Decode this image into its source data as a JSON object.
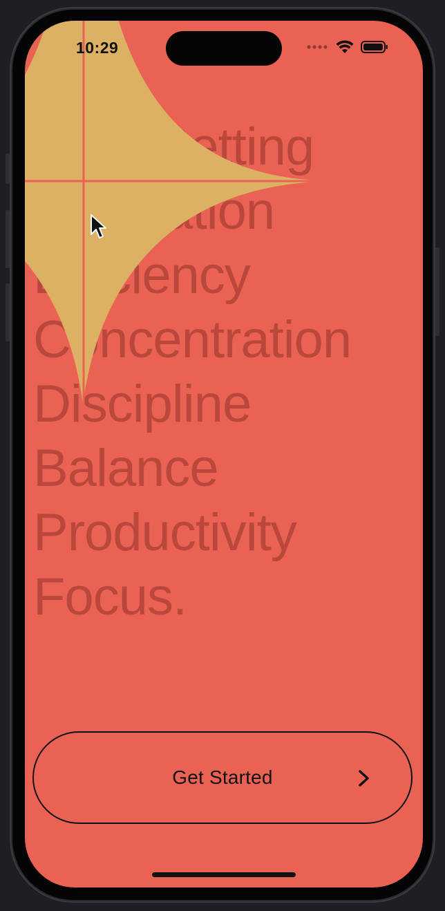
{
  "status_bar": {
    "time": "10:29",
    "icons": [
      "cellular-icon",
      "wifi-icon",
      "battery-icon"
    ]
  },
  "words": [
    "Goal Setting",
    "Dedication",
    "Efficiency",
    "Concentration",
    "Discipline",
    "Balance",
    "Productivity",
    "Focus."
  ],
  "cta": {
    "label": "Get Started",
    "icon": "chevron-right-icon"
  },
  "colors": {
    "background": "#ea6253",
    "word_text": "#b9473c",
    "sparkle": "#dcb163",
    "button_border": "#111111"
  }
}
